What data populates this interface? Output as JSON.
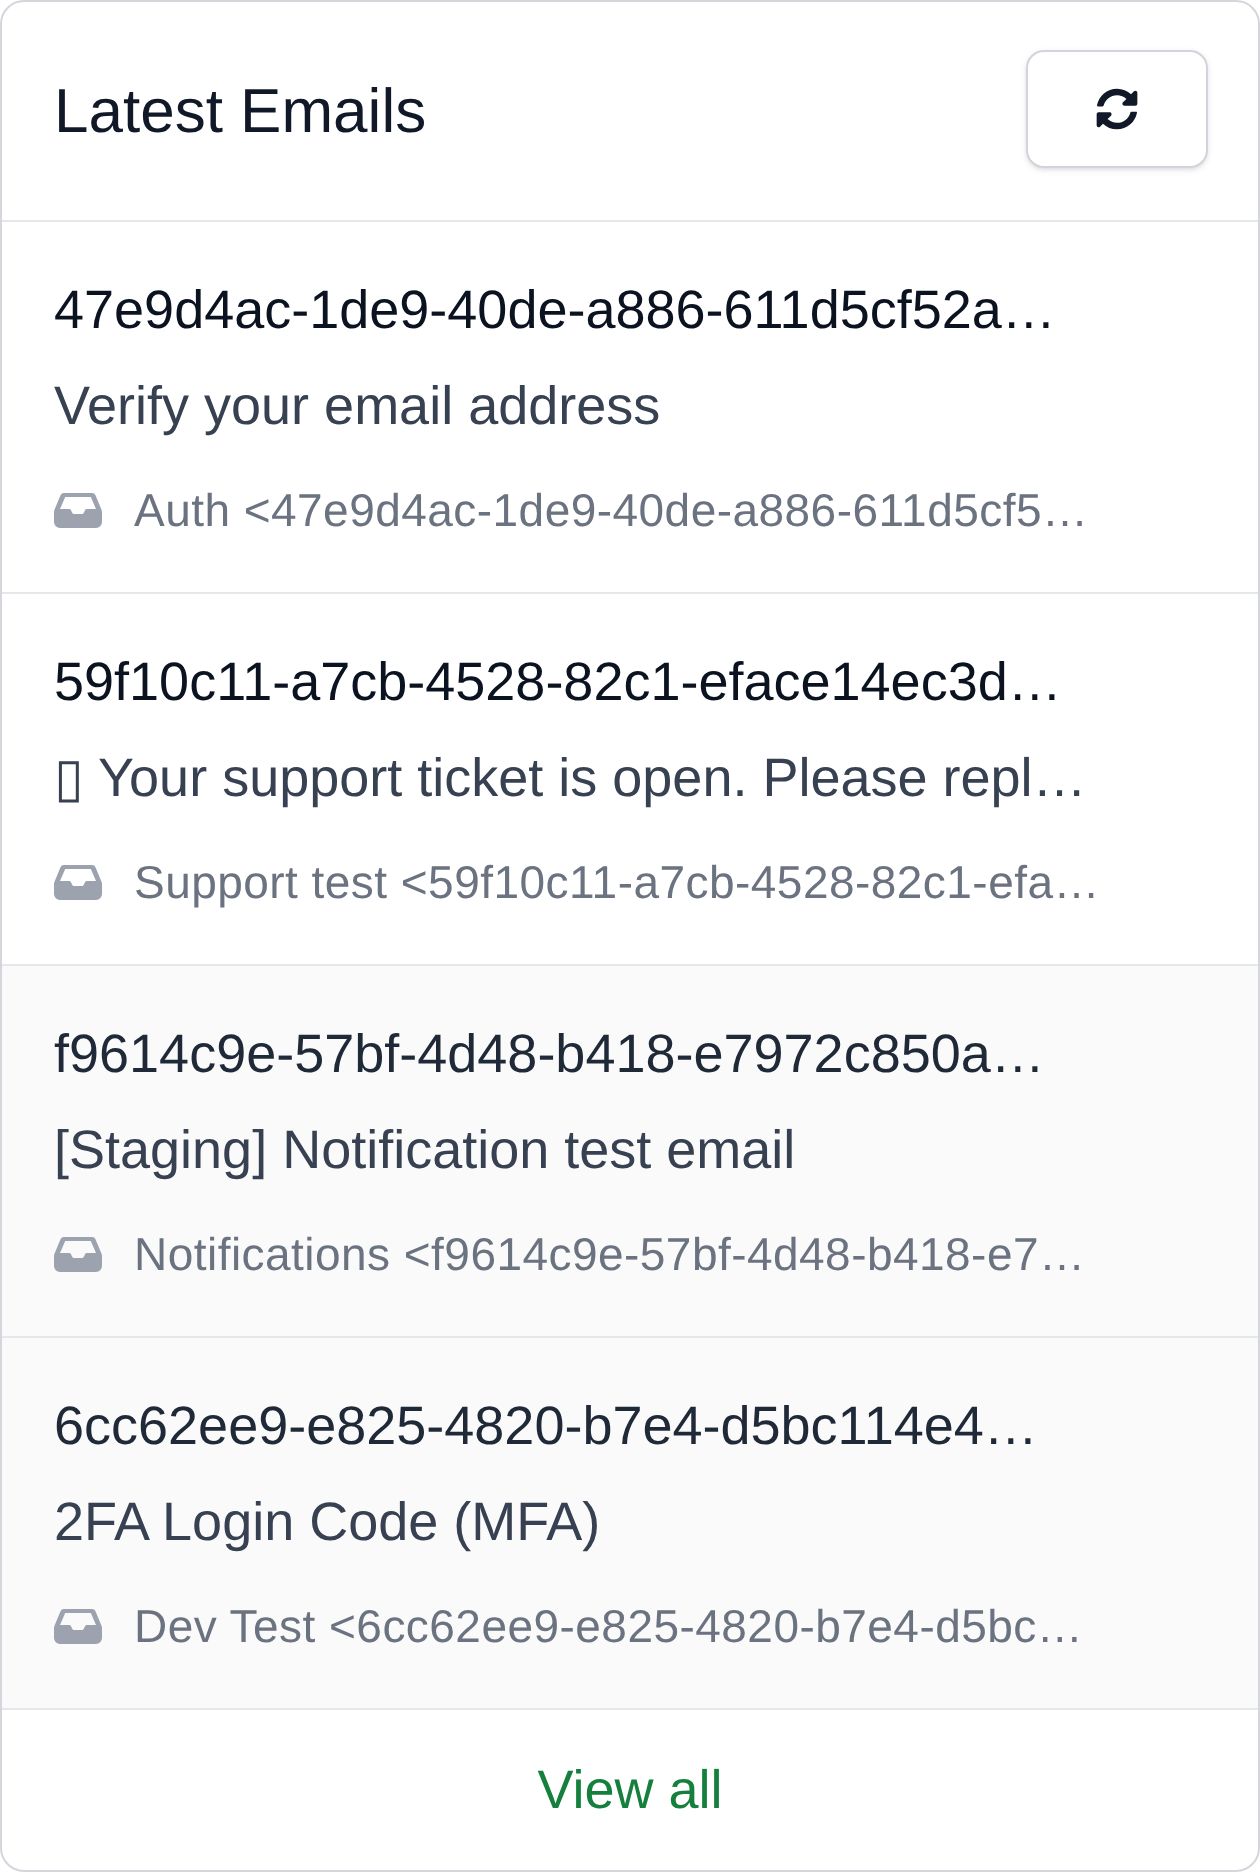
{
  "header": {
    "title": "Latest Emails"
  },
  "emails": [
    {
      "to": "47e9d4ac-1de9-40de-a886-611d5cf52a…",
      "subject": "Verify your email address",
      "sender": "Auth <47e9d4ac-1de9-40de-a886-611d5cf5…",
      "read": false
    },
    {
      "to": "59f10c11-a7cb-4528-82c1-eface14ec3d…",
      "subject": "▯ Your support ticket is open. Please repl…",
      "sender": "Support test <59f10c11-a7cb-4528-82c1-efa…",
      "read": false
    },
    {
      "to": "f9614c9e-57bf-4d48-b418-e7972c850a…",
      "subject": "[Staging] Notification test email",
      "sender": "Notifications <f9614c9e-57bf-4d48-b418-e7…",
      "read": true
    },
    {
      "to": "6cc62ee9-e825-4820-b7e4-d5bc114e4…",
      "subject": "2FA Login Code (MFA)",
      "sender": "Dev Test <6cc62ee9-e825-4820-b7e4-d5bc…",
      "read": true
    }
  ],
  "footer": {
    "link": "View all"
  }
}
